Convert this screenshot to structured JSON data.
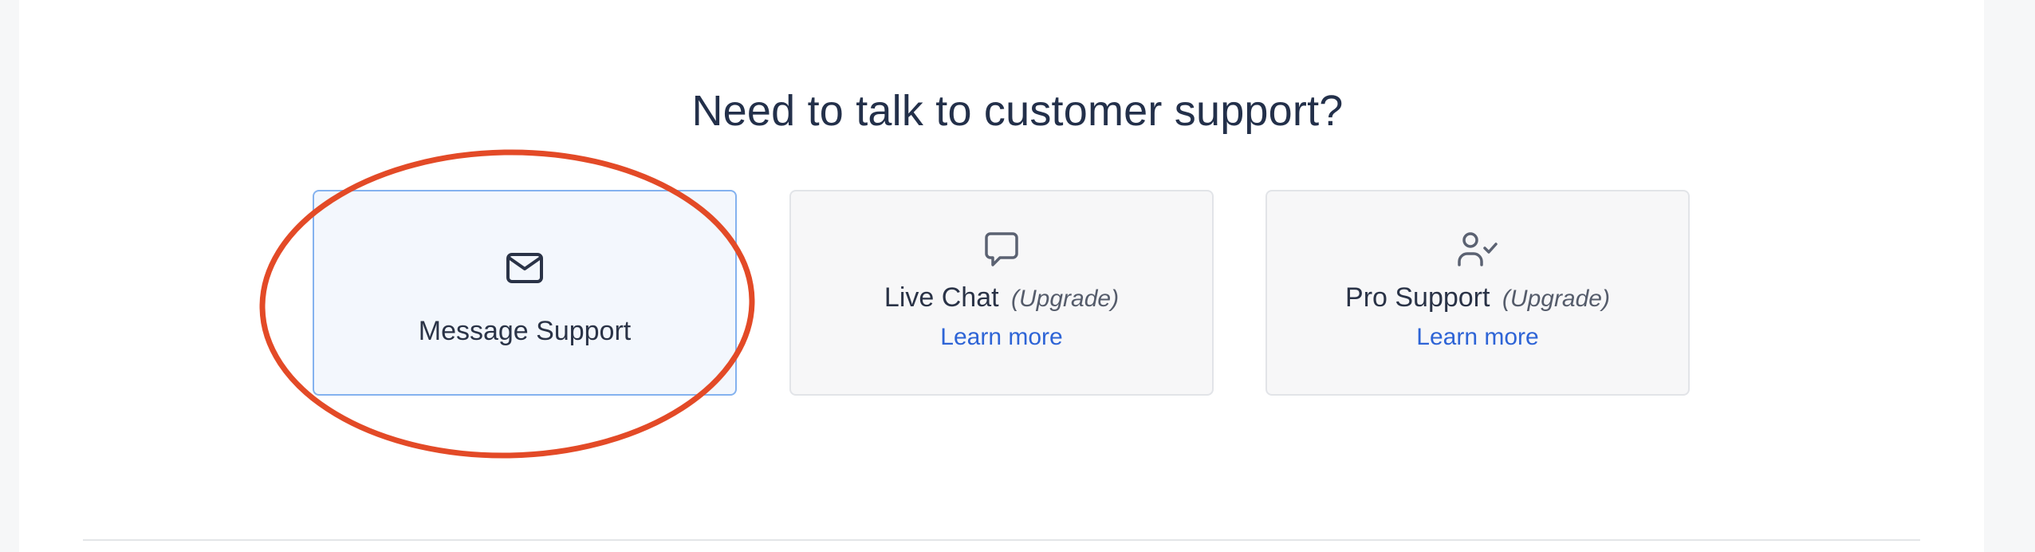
{
  "heading": "Need to talk to customer support?",
  "cards": [
    {
      "title": "Message Support",
      "icon": "envelope-icon",
      "selected": true
    },
    {
      "title": "Live Chat",
      "badge": "(Upgrade)",
      "link": "Learn more",
      "icon": "chat-bubble-icon"
    },
    {
      "title": "Pro Support",
      "badge": "(Upgrade)",
      "link": "Learn more",
      "icon": "user-check-icon"
    }
  ],
  "colors": {
    "heading": "#23304a",
    "link": "#2e64d6",
    "selected_border": "#84b2ef",
    "selected_background": "#f3f7fd",
    "annotation": "#e34a27"
  }
}
